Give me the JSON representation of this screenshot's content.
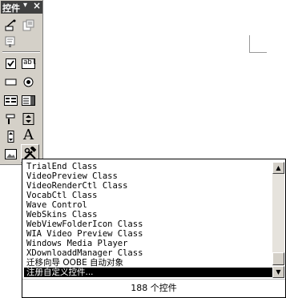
{
  "toolbox": {
    "title": "控件",
    "dropdown_glyph": "▾",
    "close_glyph": "×",
    "tools": [
      {
        "name": "tool-wizard",
        "icon": "wizard-icon"
      },
      {
        "name": "tool-properties",
        "icon": "properties-icon"
      },
      {
        "name": "tool-code",
        "icon": "code-icon"
      },
      {
        "name": "tool-checkbox",
        "icon": "checkbox-icon"
      },
      {
        "name": "tool-label",
        "icon": "label-icon",
        "text": "abl"
      },
      {
        "name": "tool-rectangle",
        "icon": "rectangle-icon"
      },
      {
        "name": "tool-option-button",
        "icon": "option-button-icon"
      },
      {
        "name": "tool-listbox",
        "icon": "listbox-icon"
      },
      {
        "name": "tool-combobox",
        "icon": "combobox-icon"
      },
      {
        "name": "tool-line",
        "icon": "line-icon"
      },
      {
        "name": "tool-spinner",
        "icon": "spinner-icon"
      },
      {
        "name": "tool-scrollbar",
        "icon": "scrollbar-icon"
      },
      {
        "name": "tool-text",
        "icon": "text-icon",
        "text": "A"
      },
      {
        "name": "tool-image",
        "icon": "image-icon"
      },
      {
        "name": "tool-more-controls",
        "icon": "hammer-wrench-icon"
      }
    ]
  },
  "component_list": {
    "items": [
      "TrialEnd Class",
      "VideoPreview Class",
      "VideoRenderCtl Class",
      "VocabCtl Class",
      "Wave Control",
      "WebSkins Class",
      "WebViewFolderIcon Class",
      "WIA Video Preview Class",
      "Windows Media Player",
      "XDownloaddManager Class",
      "迁移向导 OOBE 自动对象",
      "注册自定义控件..."
    ],
    "selected_index": 11,
    "status": "188 个控件",
    "scroll_up_glyph": "▲",
    "scroll_down_glyph": "▼"
  }
}
